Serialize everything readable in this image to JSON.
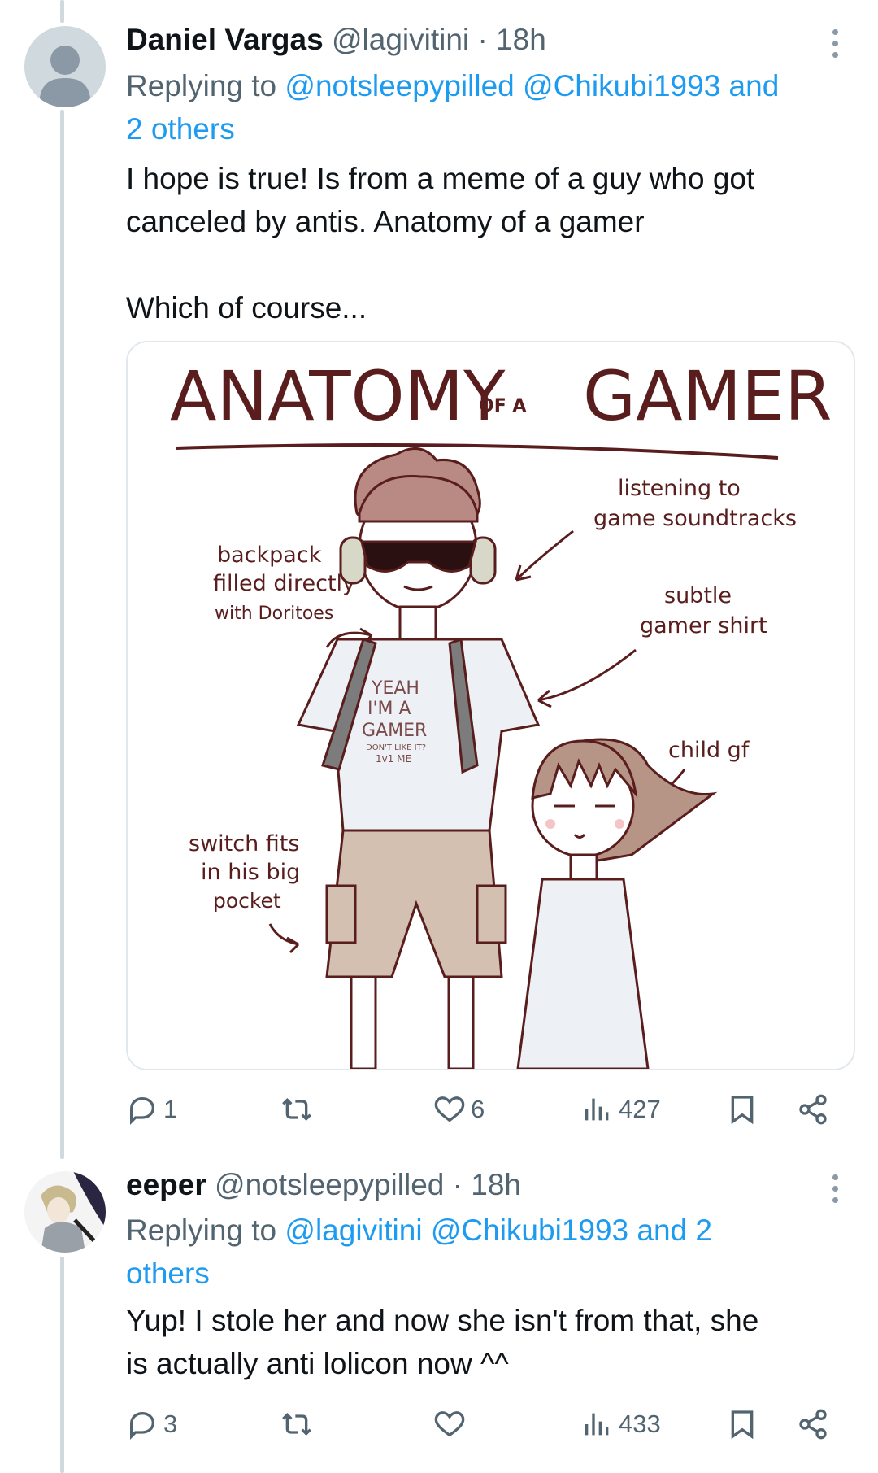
{
  "thread": [
    {
      "author": {
        "name": "Daniel Vargas",
        "handle": "@lagivitini",
        "time": "18h"
      },
      "reply": {
        "prefix": "Replying to",
        "mentions": "@notsleepypilled @Chikubi1993 and",
        "mentions_line2": "2 others"
      },
      "text_lines": [
        "I hope is true! Is from a meme of a guy who got",
        "canceled by antis. Anatomy of a gamer",
        "",
        "Which of course..."
      ],
      "image": {
        "title_main_left": "ANATOMY",
        "title_small": "OF A",
        "title_main_right": "GAMER",
        "annotations": {
          "soundtracks_1": "listening to",
          "soundtracks_2": "game soundtracks",
          "backpack_1": "backpack",
          "backpack_2": "filled directly",
          "backpack_3": "with Doritoes",
          "shirt_1": "subtle",
          "shirt_2": "gamer shirt",
          "gf": "child gf",
          "switch_1": "switch fits",
          "switch_2": "in his big",
          "switch_3": "pocket"
        },
        "shirt_text": {
          "l1": "YEAH",
          "l2": "I'M A",
          "l3": "GAMER",
          "l4": "DON'T LIKE IT?",
          "l5": "1v1 ME"
        }
      },
      "stats": {
        "replies": "1",
        "reposts": "",
        "likes": "6",
        "views": "427"
      }
    },
    {
      "author": {
        "name": "eeper",
        "handle": "@notsleepypilled",
        "time": "18h"
      },
      "reply": {
        "prefix": "Replying to",
        "mentions": "@lagivitini @Chikubi1993 and 2",
        "mentions_line2": "others"
      },
      "text_lines": [
        "Yup! I stole her and now she isn't from that, she",
        "is actually anti lolicon now ^^"
      ],
      "stats": {
        "replies": "3",
        "reposts": "",
        "likes": "",
        "views": "433"
      }
    }
  ],
  "colors": {
    "link": "#1d9bf0",
    "secondary": "#536471",
    "ink": "#5a1d1d"
  },
  "icons": [
    "reply-icon",
    "repost-icon",
    "like-icon",
    "views-icon",
    "bookmark-icon",
    "share-icon",
    "more-icon"
  ]
}
